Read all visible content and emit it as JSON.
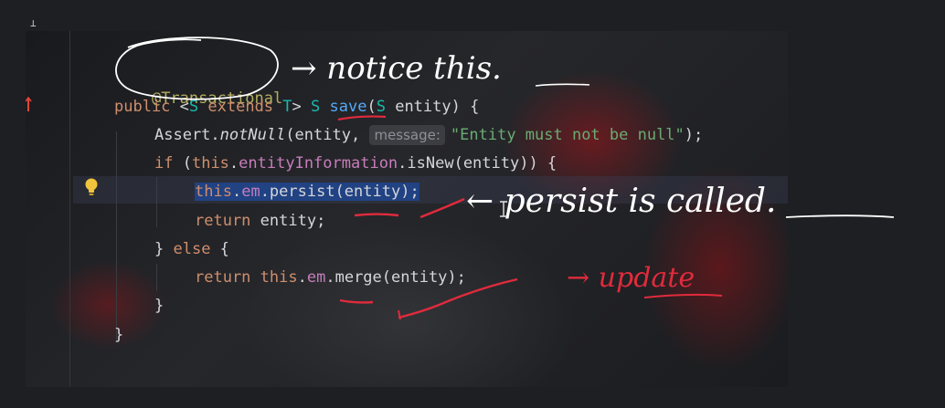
{
  "editor": {
    "code_lines": {
      "annotation": "@Transactional",
      "l2_kw_public": "public",
      "l2_lt": " <",
      "l2_S": "S",
      "l2_extends": " extends ",
      "l2_T": "T",
      "l2_gt": "> ",
      "l2_S2": "S",
      "l2_space": " ",
      "l2_save": "save",
      "l2_paren": "(",
      "l2_S3": "S",
      "l2_rest": " entity) {",
      "l3_assert": "Assert.",
      "l3_notnull": "notNull",
      "l3_args": "(entity, ",
      "l3_hint": "message:",
      "l3_str": "\"Entity must not be null\"",
      "l3_end": ");",
      "l4_if": "if",
      "l4_open": " (",
      "l4_this": "this",
      "l4_dot": ".",
      "l4_field": "entityInformation",
      "l4_rest": ".isNew(entity)) {",
      "l5_this": "this",
      "l5_dot": ".",
      "l5_em": "em",
      "l5_rest": ".persist(entity);",
      "l6_return": "return",
      "l6_rest": " entity;",
      "l7_close": "} ",
      "l7_else": "else",
      "l7_rest": " {",
      "l8_return": "return",
      "l8_space": " ",
      "l8_this": "this",
      "l8_dot": ".",
      "l8_em": "em",
      "l8_rest": ".merge(entity);",
      "l9": "}",
      "l10": "}"
    },
    "gutter_icons": {
      "intention": "lightbulb-icon",
      "run_marker": "override-marker-icon",
      "corner": "pin-icon"
    }
  },
  "handwriting": {
    "notice": "→ notice this.",
    "persist_note": "← persist is called.",
    "update_note": "→ update"
  },
  "colors": {
    "background": "#1e1f22",
    "keyword": "#cf8e6d",
    "annotation": "#b3ae60",
    "type_param": "#16baac",
    "function": "#56a8f5",
    "field": "#c77dbb",
    "string": "#6aab73",
    "selection": "#214283",
    "ink_white": "#ffffff",
    "ink_red": "#e02b3c"
  }
}
